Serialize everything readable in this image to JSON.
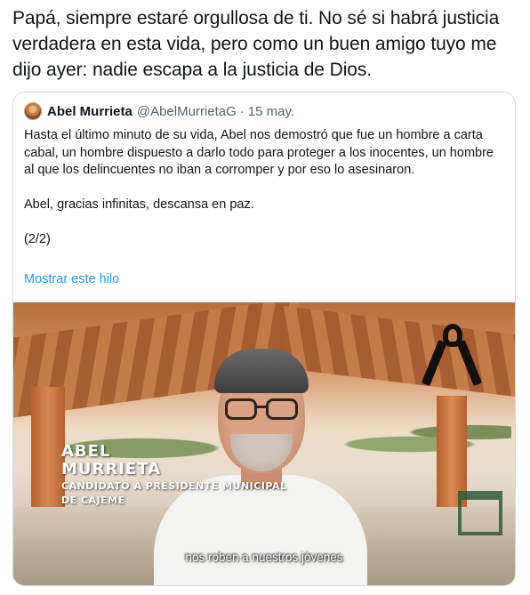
{
  "tweet": {
    "text": "Papá, siempre estaré orgullosa de ti. No sé si habrá justicia verdadera en esta vida, pero como un buen amigo tuyo me dijo ayer: nadie escapa a la justicia de Dios."
  },
  "quoted_tweet": {
    "author_name": "Abel Murrieta",
    "author_handle": "@AbelMurrietaG",
    "separator": "·",
    "date": "15 may.",
    "paragraphs": [
      "Hasta el último minuto de su vida, Abel nos demostró que fue un hombre a carta cabal, un hombre dispuesto a darlo todo para proteger a los inocentes, un hombre al que los delincuentes no iban a corromper y por eso lo asesinaron.",
      "Abel, gracias infinitas, descansa en paz.",
      "(2/2)"
    ],
    "show_thread_label": "Mostrar este hilo"
  },
  "video": {
    "lower_third_first": "ABEL",
    "lower_third_last": "MURRIETA",
    "lower_third_role_1": "CANDIDATO A PRESIDENTE MUNICIPAL",
    "lower_third_role_2": "DE CAJEME",
    "subtitle": "nos roben a nuestros jóvenes"
  },
  "colors": {
    "link": "#1d9bf0",
    "muted": "#536471",
    "border": "#cfd9de",
    "text": "#0f1419"
  }
}
